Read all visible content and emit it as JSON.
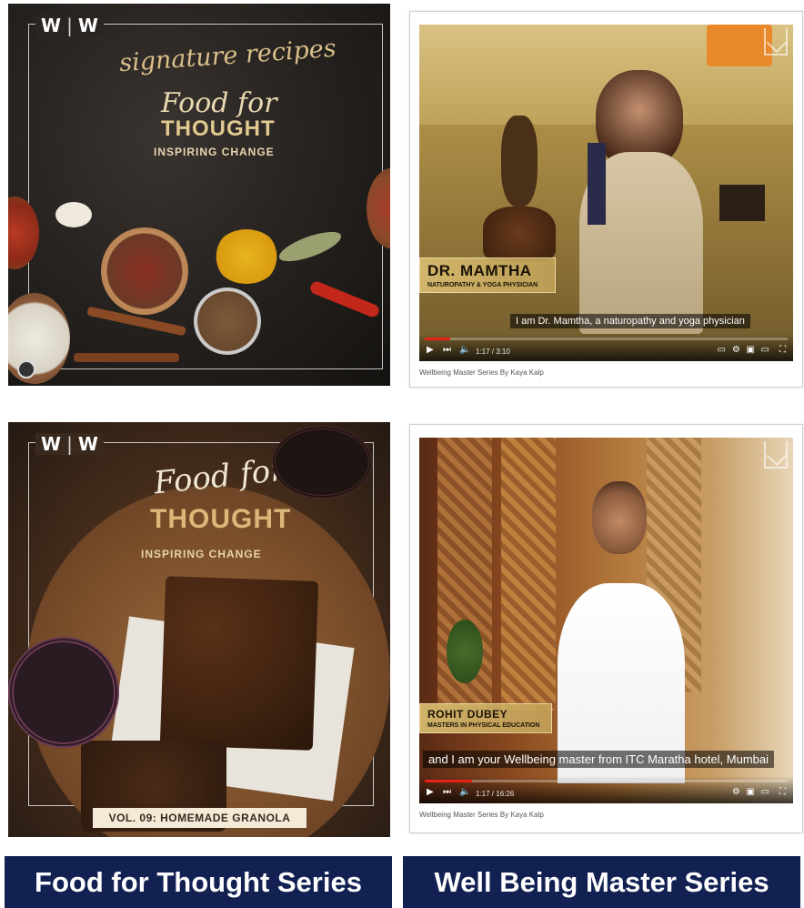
{
  "brand": {
    "logo_left": "W",
    "logo_right": "W",
    "logo_separator": "|"
  },
  "food_card_1": {
    "script_title": "signature recipes",
    "food_for": "Food for",
    "thought": "THOUGHT",
    "tagline": "INSPIRING CHANGE"
  },
  "food_card_2": {
    "food_for": "Food for",
    "thought": "THOUGHT",
    "tagline": "INSPIRING CHANGE",
    "volume_label": "VOL. 09: HOMEMADE GRANOLA"
  },
  "video_1": {
    "speaker_name": "DR. MAMTHA",
    "speaker_role": "NATUROPATHY & YOGA PHYSICIAN",
    "subtitle": "I am Dr. Mamtha, a naturopathy and yoga physician",
    "time": "1:17 / 3:10",
    "progress": 0.07,
    "channel_caption": "Wellbeing Master Series By Kaya Kalp"
  },
  "video_2": {
    "speaker_name": "ROHIT DUBEY",
    "speaker_role": "MASTERS IN PHYSICAL EDUCATION",
    "subtitle": "and I am your Wellbeing master from ITC Maratha hotel, Mumbai",
    "time": "1:17 / 16:26",
    "progress": 0.13,
    "channel_caption": "Wellbeing Master Series By Kaya Kalp"
  },
  "labels": {
    "left": "Food for Thought Series",
    "right": "Well Being Master Series"
  },
  "icons": {
    "play": "play-icon",
    "next": "next-icon",
    "volume": "volume-icon",
    "settings": "gear-icon",
    "fullscreen": "fullscreen-icon",
    "watermark": "brand-watermark-icon"
  },
  "colors": {
    "label_bg": "#122152",
    "label_text": "#ffffff",
    "gold": "#d9bf8a",
    "progress": "#e62117"
  }
}
